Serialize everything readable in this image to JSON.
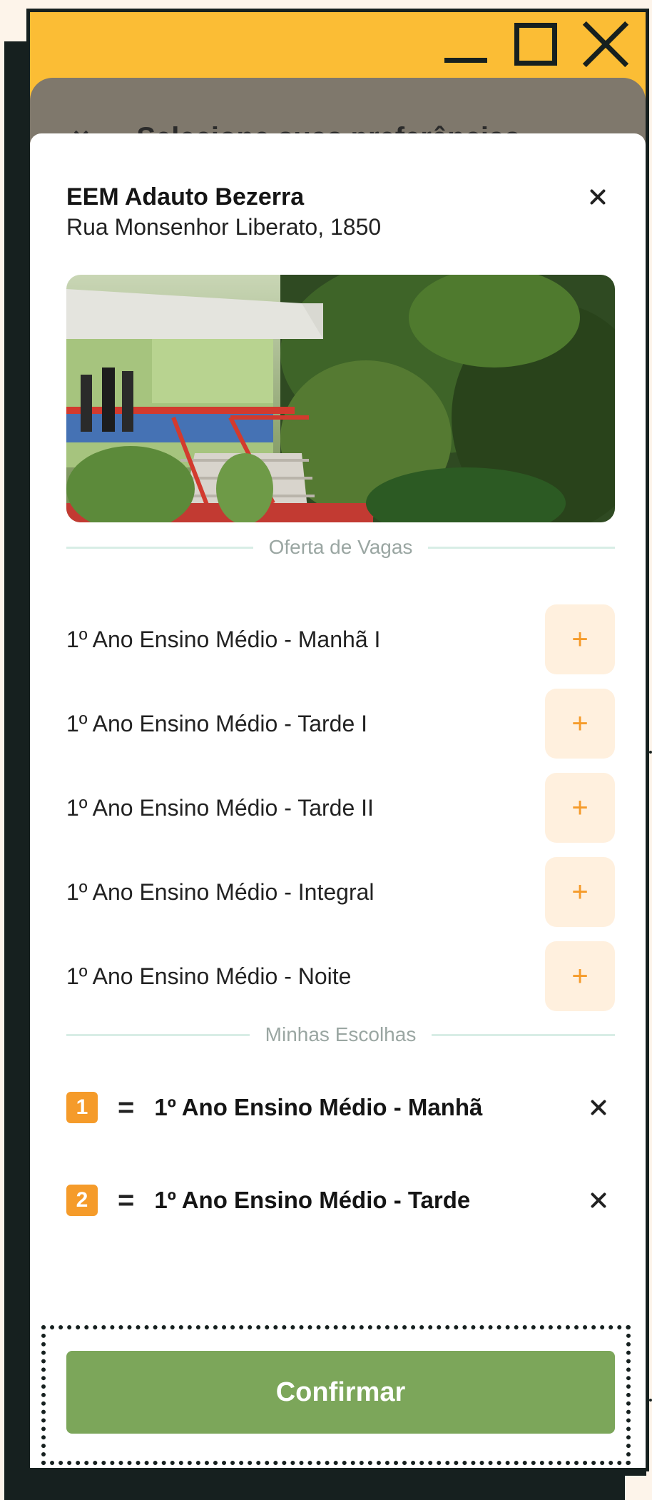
{
  "backdrop": {
    "title": "Selecione suas preferências",
    "close_glyph": "×"
  },
  "school": {
    "name": "EEM Adauto Bezerra",
    "address": "Rua Monsenhor Liberato, 1850"
  },
  "sections": {
    "offers_title": "Oferta de Vagas",
    "choices_title": "Minhas Escolhas"
  },
  "offers": [
    {
      "label": "1º Ano Ensino Médio - Manhã I",
      "add_glyph": "+"
    },
    {
      "label": "1º Ano Ensino Médio - Tarde I",
      "add_glyph": "+"
    },
    {
      "label": "1º Ano Ensino Médio - Tarde II",
      "add_glyph": "+"
    },
    {
      "label": "1º Ano Ensino Médio - Integral",
      "add_glyph": "+"
    },
    {
      "label": "1º Ano Ensino Médio - Noite",
      "add_glyph": "+"
    }
  ],
  "choices": [
    {
      "number": "1",
      "separator": "=",
      "label": "1º Ano Ensino Médio - Manhã"
    },
    {
      "number": "2",
      "separator": "=",
      "label": "1º Ano Ensino Médio - Tarde"
    }
  ],
  "confirm_label": "Confirmar",
  "colors": {
    "accent_yellow": "#fbbd35",
    "accent_orange": "#f59b2a",
    "confirm_green": "#7ca65a",
    "dark": "#16201f"
  },
  "icons": {
    "minimize": "minimize-icon",
    "maximize": "maximize-icon",
    "close": "close-icon",
    "add": "plus-icon",
    "remove": "close-icon"
  }
}
